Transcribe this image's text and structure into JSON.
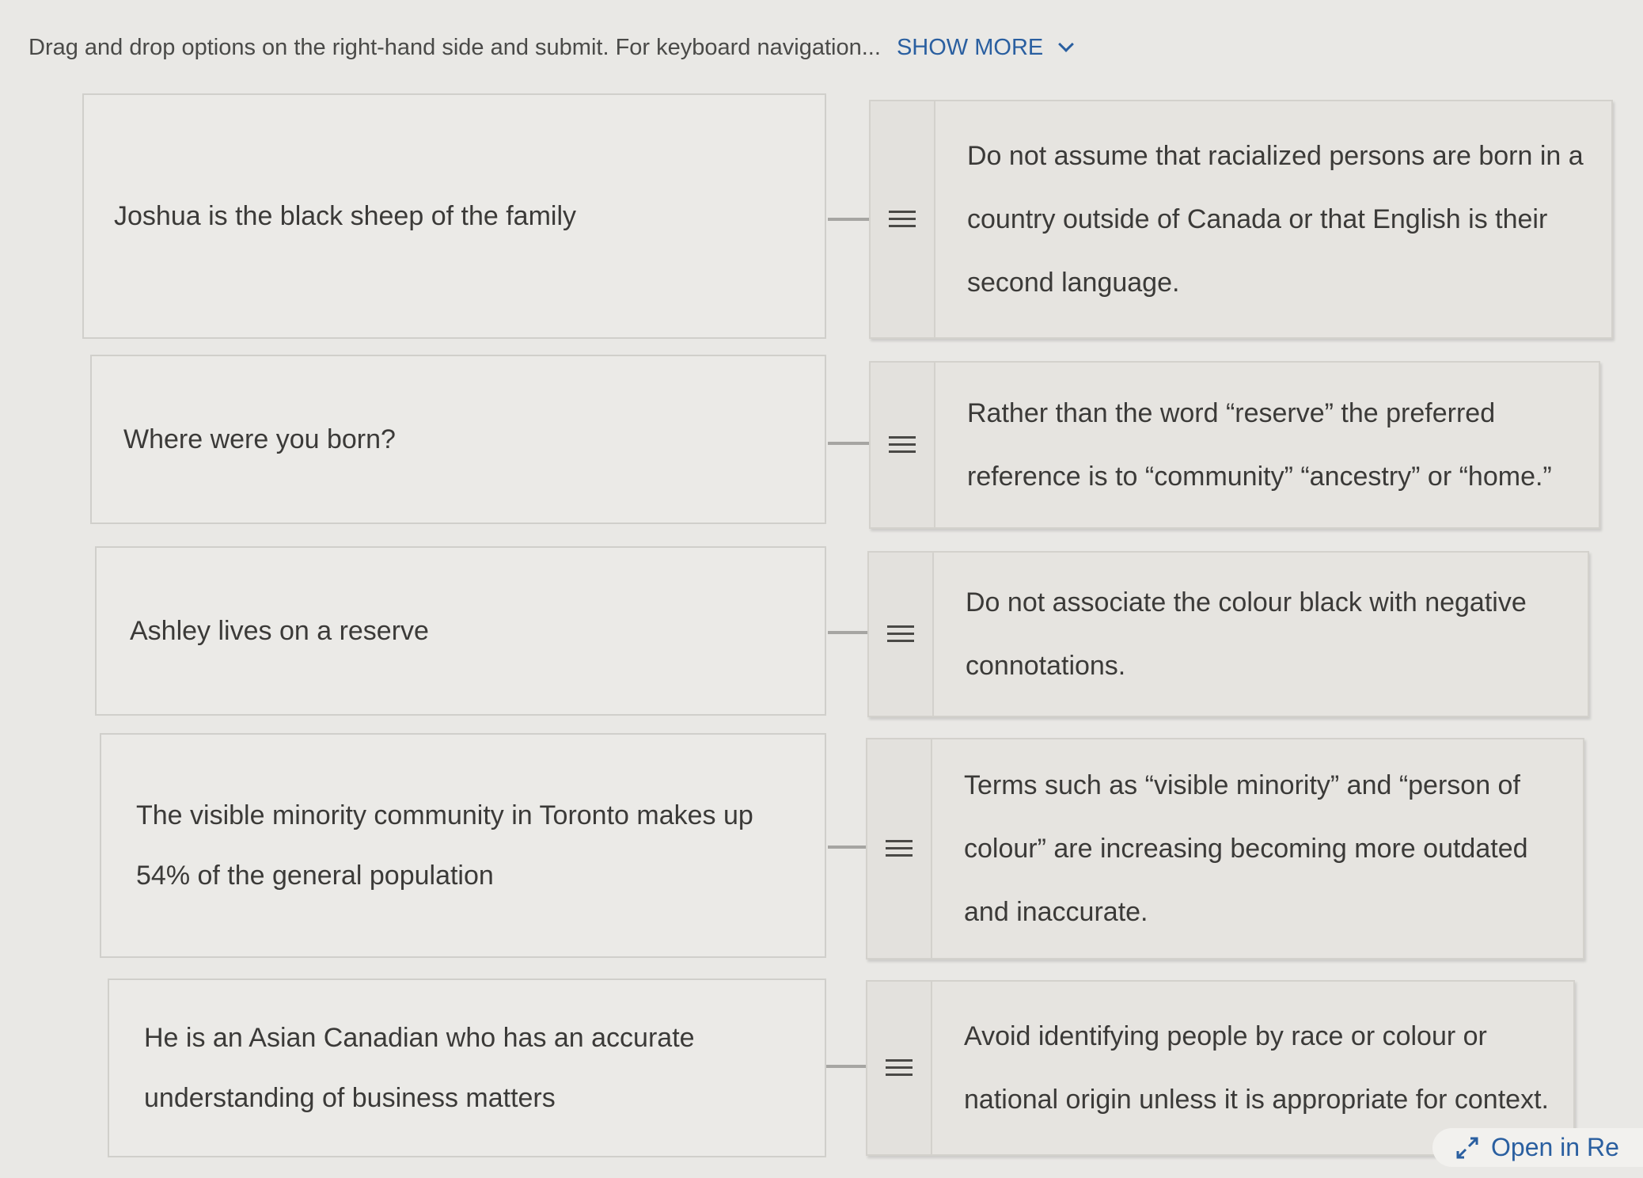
{
  "instructions": {
    "text": "Drag and drop options on the right-hand side and submit. For keyboard navigation...",
    "show_more": "SHOW MORE"
  },
  "rows": [
    {
      "prompt_lines": [
        "Joshua is the black sheep of the family"
      ],
      "answer_lines": [
        "Do not assume that racialized persons are born in a",
        "country outside of Canada or that English is their",
        "second language."
      ]
    },
    {
      "prompt_lines": [
        "Where were you born?"
      ],
      "answer_lines": [
        "Rather than the word “reserve” the preferred",
        "reference is to “community” “ancestry” or “home.”"
      ]
    },
    {
      "prompt_lines": [
        "Ashley lives on a reserve"
      ],
      "answer_lines": [
        "Do not associate the colour black with negative",
        "connotations."
      ]
    },
    {
      "prompt_lines": [
        "The visible minority community in Toronto makes up",
        "54% of the general population"
      ],
      "answer_lines": [
        "Terms such as “visible minority” and “person of",
        "colour” are increasing becoming more outdated and",
        "inaccurate."
      ]
    },
    {
      "prompt_lines": [
        "He is an Asian Canadian who has an accurate",
        "understanding of business matters"
      ],
      "answer_lines": [
        "Avoid identifying people by race or colour or",
        "national origin unless it is appropriate for context."
      ]
    }
  ],
  "open_link": "Open in Re",
  "icons": {
    "drag_handle": "drag-handle-icon",
    "chevron": "chevron-down-icon",
    "expand": "expand-arrows-icon"
  },
  "colors": {
    "link": "#2a5fa0",
    "card": "#e6e4e0",
    "background": "#e9e8e5"
  }
}
